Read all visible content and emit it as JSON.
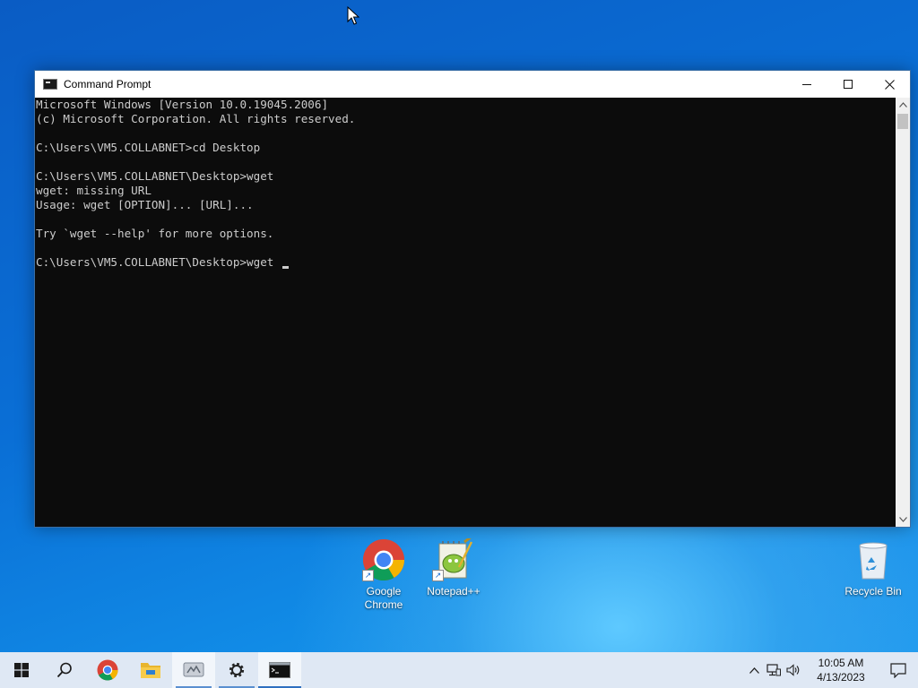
{
  "window": {
    "title": "Command Prompt",
    "minimize_glyph": "—",
    "maximize_glyph": "☐",
    "close_glyph": "✕",
    "lines": [
      "Microsoft Windows [Version 10.0.19045.2006]",
      "(c) Microsoft Corporation. All rights reserved.",
      "",
      "C:\\Users\\VM5.COLLABNET>cd Desktop",
      "",
      "C:\\Users\\VM5.COLLABNET\\Desktop>wget",
      "wget: missing URL",
      "Usage: wget [OPTION]... [URL]...",
      "",
      "Try `wget --help' for more options.",
      "",
      "C:\\Users\\VM5.COLLABNET\\Desktop>wget "
    ]
  },
  "desktop": {
    "icons": [
      {
        "label": "Google Chrome",
        "icon": "chrome-icon"
      },
      {
        "label": "Notepad++",
        "icon": "notepad-plus-plus-icon"
      },
      {
        "label": "Recycle Bin",
        "icon": "recycle-bin-icon"
      }
    ]
  },
  "taskbar": {
    "items": [
      "start-icon",
      "search-icon",
      "chrome-icon",
      "file-explorer-icon",
      "app-icon",
      "settings-icon",
      "command-prompt-icon"
    ],
    "tray": {
      "time": "10:05 AM",
      "date": "4/13/2023"
    }
  },
  "colors": {
    "console_bg": "#0c0c0c",
    "console_text": "#cccccc",
    "taskbar_bg": "#dfe8f4",
    "accent": "#2e6fc0"
  }
}
